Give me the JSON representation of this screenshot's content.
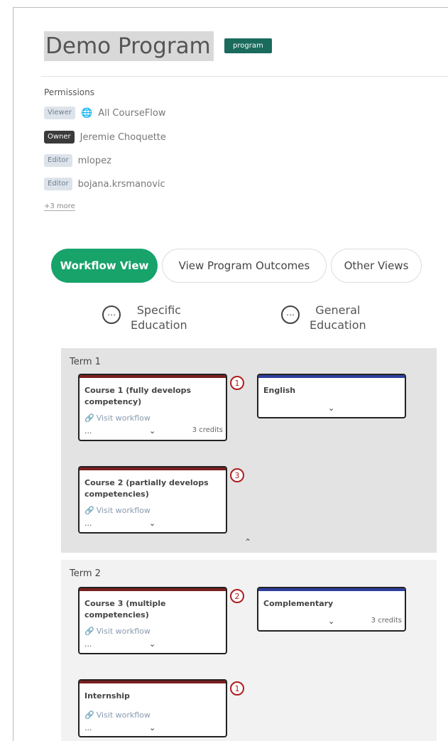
{
  "program": {
    "title": "Demo Program",
    "type_badge": "program"
  },
  "permissions": {
    "heading": "Permissions",
    "entries": [
      {
        "role": "Viewer",
        "name": "All CourseFlow",
        "icon": "globe-icon"
      },
      {
        "role": "Owner",
        "name": "Jeremie Choquette"
      },
      {
        "role": "Editor",
        "name": "mlopez"
      },
      {
        "role": "Editor",
        "name": "bojana.krsmanovic"
      }
    ],
    "more_label": "+3 more"
  },
  "tabs": [
    {
      "label": "Workflow View",
      "active": true
    },
    {
      "label": "View Program Outcomes",
      "active": false
    },
    {
      "label": "Other Views",
      "active": false
    }
  ],
  "columns": [
    {
      "label_line1": "Specific",
      "label_line2": "Education",
      "icon": "ellipsis-circle-icon"
    },
    {
      "label_line1": "General",
      "label_line2": "Education",
      "icon": "ellipsis-circle-icon"
    }
  ],
  "terms": [
    {
      "label": "Term 1",
      "nodes": [
        {
          "title": "Course 1 (fully develops competency)",
          "visit": "Visit workflow",
          "dots": "...",
          "credits": "3 credits",
          "outcome_count": "1"
        },
        {
          "title": "English"
        },
        {
          "title": "Course 2 (partially develops competencies)",
          "visit": "Visit workflow",
          "dots": "...",
          "outcome_count": "3"
        }
      ]
    },
    {
      "label": "Term 2",
      "nodes": [
        {
          "title": "Course 3 (multiple competencies)",
          "visit": "Visit workflow",
          "dots": "...",
          "outcome_count": "2"
        },
        {
          "title": "Complementary",
          "credits": "3 credits"
        },
        {
          "title": "Internship",
          "visit": "Visit workflow",
          "dots": "...",
          "outcome_count": "1"
        }
      ]
    }
  ],
  "colors": {
    "specific_education_bar": "#7a1f1f",
    "general_education_bar": "#2f3f9f",
    "active_tab": "#18a36b",
    "type_badge": "#1b6b5d",
    "outcome_badge": "#b01e1e"
  }
}
